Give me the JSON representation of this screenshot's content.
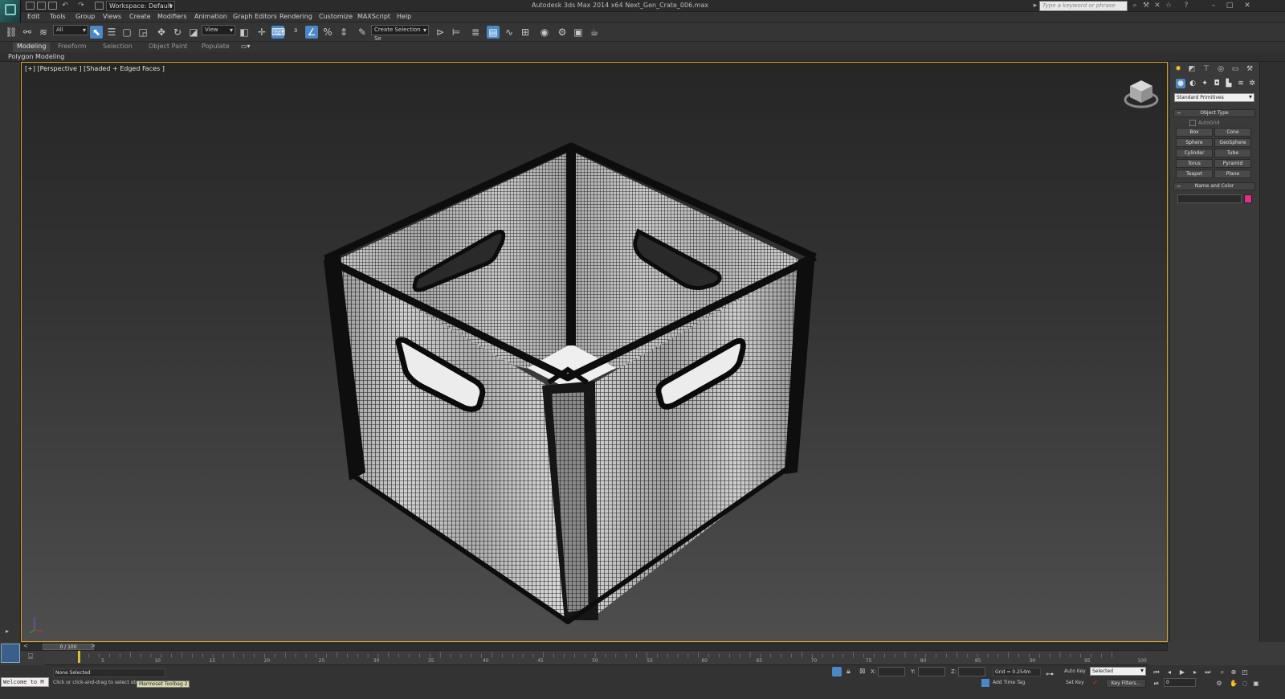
{
  "window": {
    "app_title": "Autodesk 3ds Max  2014 x64     Next_Gen_Crate_006.max",
    "workspace": "Workspace: Default",
    "search_placeholder": "Type a keyword or phrase"
  },
  "menu": [
    "Edit",
    "Tools",
    "Group",
    "Views",
    "Create",
    "Modifiers",
    "Animation",
    "Graph Editors",
    "Rendering",
    "Customize",
    "MAXScript",
    "Help"
  ],
  "toolbar": {
    "selection_filter": "All",
    "reference_coord": "View",
    "named_selection": "Create Selection Se"
  },
  "ribbon": {
    "tabs": [
      "Modeling",
      "Freeform",
      "Selection",
      "Object Paint",
      "Populate"
    ],
    "active_tab": "Modeling",
    "subpanel": "Polygon Modeling"
  },
  "viewport": {
    "label": "[+] [Perspective ] [Shaded + Edged Faces ]",
    "mesh_color": "#e6e6e6",
    "wire_color": "#111111"
  },
  "command_panel": {
    "category": "Standard Primitives",
    "object_type_title": "Object Type",
    "autogrid": "AutoGrid",
    "primitives": [
      "Box",
      "Cone",
      "Sphere",
      "GeoSphere",
      "Cylinder",
      "Tube",
      "Torus",
      "Pyramid",
      "Teapot",
      "Plane"
    ],
    "name_color_title": "Name and Color",
    "swatch_color": "#e0308a"
  },
  "timeline": {
    "frame_display": "0 / 100",
    "ticks": [
      0,
      5,
      10,
      15,
      20,
      25,
      30,
      35,
      40,
      45,
      50,
      55,
      60,
      65,
      70,
      75,
      80,
      85,
      90,
      95,
      100
    ]
  },
  "status": {
    "selection": "None Selected",
    "prompt": "Click or click-and-drag to select ob",
    "listener": "Welcome to M",
    "tooltip": "Marmoset Toolbag 2",
    "x_label": "X:",
    "y_label": "Y:",
    "z_label": "Z:",
    "grid": "Grid = 0.254m",
    "add_time_tag": "Add Time Tag",
    "auto_key": "Auto Key",
    "set_key": "Set Key",
    "key_mode": "Selected",
    "key_filters": "Key Filters...",
    "current_frame": "0"
  }
}
